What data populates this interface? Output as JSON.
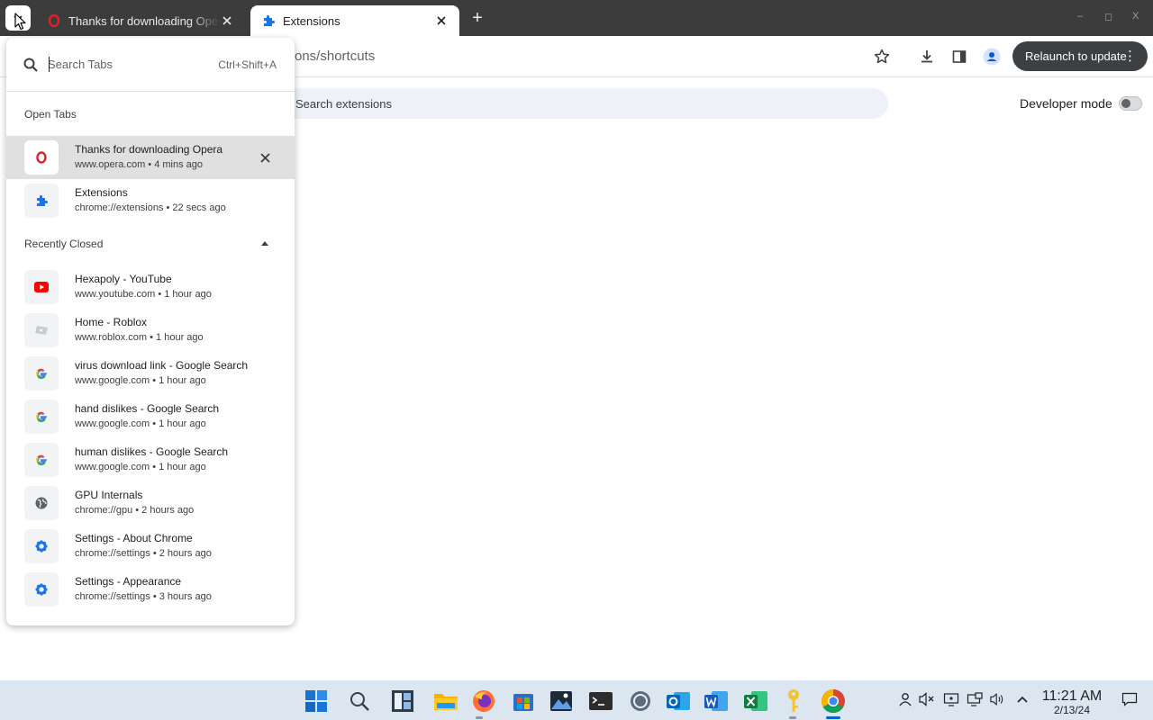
{
  "browser": {
    "tabs": [
      {
        "title": "Thanks for downloading Opera",
        "favicon": "opera-icon",
        "active": false
      },
      {
        "title": "Extensions",
        "favicon": "puzzle-icon",
        "active": true
      }
    ],
    "new_tab_symbol": "+",
    "window_controls": [
      "–",
      "◻",
      "X"
    ]
  },
  "toolbar": {
    "omnibox_text": "ons/shortcuts",
    "relaunch_label": "Relaunch to update",
    "menu_symbol": "⋮"
  },
  "extensions_page": {
    "search_placeholder": "Search extensions",
    "developer_mode_label": "Developer mode",
    "developer_mode_on": false
  },
  "tab_search": {
    "placeholder": "Search Tabs",
    "shortcut": "Ctrl+Shift+A",
    "open_tabs_heading": "Open Tabs",
    "recently_closed_heading": "Recently Closed",
    "open_tabs": [
      {
        "title": "Thanks for downloading Opera",
        "meta": "www.opera.com • 4 mins ago",
        "icon": "opera-icon",
        "selected": true
      },
      {
        "title": "Extensions",
        "meta": "chrome://extensions • 22 secs ago",
        "icon": "puzzle-icon",
        "selected": false
      }
    ],
    "recently_closed": [
      {
        "title": "Hexapoly - YouTube",
        "meta": "www.youtube.com • 1 hour ago",
        "icon": "youtube-icon"
      },
      {
        "title": "Home - Roblox",
        "meta": "www.roblox.com • 1 hour ago",
        "icon": "roblox-icon"
      },
      {
        "title": "virus download link - Google Search",
        "meta": "www.google.com • 1 hour ago",
        "icon": "google-icon"
      },
      {
        "title": "hand dislikes - Google Search",
        "meta": "www.google.com • 1 hour ago",
        "icon": "google-icon"
      },
      {
        "title": "human dislikes - Google Search",
        "meta": "www.google.com • 1 hour ago",
        "icon": "google-icon"
      },
      {
        "title": "GPU Internals",
        "meta": "chrome://gpu • 2 hours ago",
        "icon": "globe-icon"
      },
      {
        "title": "Settings - About Chrome",
        "meta": "chrome://settings • 2 hours ago",
        "icon": "settings-gear-icon"
      },
      {
        "title": "Settings - Appearance",
        "meta": "chrome://settings • 3 hours ago",
        "icon": "settings-gear-icon"
      }
    ]
  },
  "taskbar": {
    "apps": [
      "windows-start-icon",
      "search-icon",
      "widgets-icon",
      "file-explorer-icon",
      "firefox-icon",
      "store-icon",
      "photos-icon",
      "terminal-icon",
      "generic-app-icon",
      "outlook-icon",
      "word-icon",
      "excel-icon",
      "keys-icon",
      "chrome-icon"
    ],
    "tray": [
      "person-icon",
      "mute-icon",
      "display-icon",
      "monitor-icon",
      "volume-icon",
      "chevron-up-icon",
      "notification-icon"
    ],
    "time": "11:21 AM",
    "date": "2/13/24"
  },
  "colors": {
    "accent_blue": "#1a73e8",
    "tabstrip": "#3c3c3c",
    "relaunch_bg": "#3c4043",
    "taskbar": "#dbe6f1"
  }
}
